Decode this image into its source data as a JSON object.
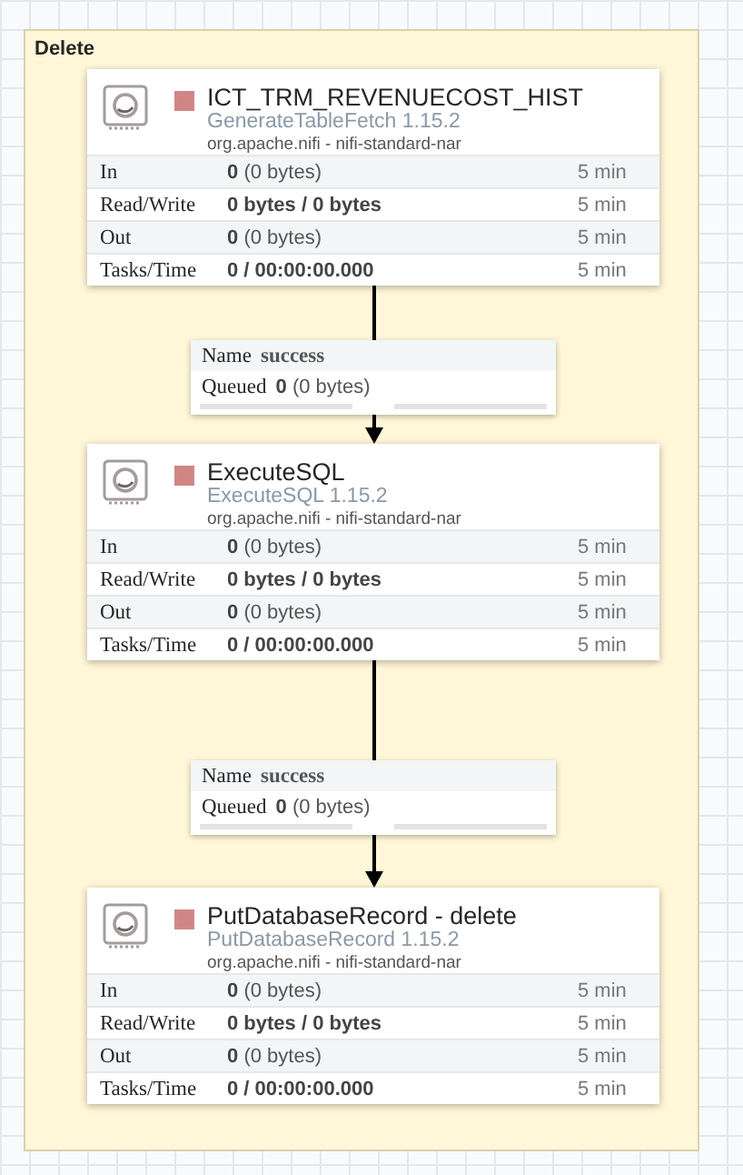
{
  "group": {
    "title": "Delete"
  },
  "flow": [
    {
      "kind": "processor",
      "stopped": true,
      "name": "ICT_TRM_REVENUECOST_HIST",
      "type": "GenerateTableFetch 1.15.2",
      "bundle": "org.apache.nifi - nifi-standard-nar",
      "stats": [
        {
          "label": "In",
          "value": "0",
          "detail": "(0 bytes)",
          "window": "5 min"
        },
        {
          "label": "Read/Write",
          "value": "0 bytes / 0 bytes",
          "window": "5 min"
        },
        {
          "label": "Out",
          "value": "0",
          "detail": "(0 bytes)",
          "window": "5 min"
        },
        {
          "label": "Tasks/Time",
          "value": "0 / 00:00:00.000",
          "window": "5 min"
        }
      ]
    },
    {
      "kind": "connection",
      "name_label": "Name",
      "name": "success",
      "queued_label": "Queued",
      "queued_count": "0",
      "queued_size": "(0 bytes)"
    },
    {
      "kind": "processor",
      "stopped": true,
      "name": "ExecuteSQL",
      "type": "ExecuteSQL 1.15.2",
      "bundle": "org.apache.nifi - nifi-standard-nar",
      "stats": [
        {
          "label": "In",
          "value": "0",
          "detail": "(0 bytes)",
          "window": "5 min"
        },
        {
          "label": "Read/Write",
          "value": "0 bytes / 0 bytes",
          "window": "5 min"
        },
        {
          "label": "Out",
          "value": "0",
          "detail": "(0 bytes)",
          "window": "5 min"
        },
        {
          "label": "Tasks/Time",
          "value": "0 / 00:00:00.000",
          "window": "5 min"
        }
      ]
    },
    {
      "kind": "connection",
      "name_label": "Name",
      "name": "success",
      "queued_label": "Queued",
      "queued_count": "0",
      "queued_size": "(0 bytes)"
    },
    {
      "kind": "processor",
      "stopped": true,
      "name": "PutDatabaseRecord - delete",
      "type": "PutDatabaseRecord 1.15.2",
      "bundle": "org.apache.nifi - nifi-standard-nar",
      "stats": [
        {
          "label": "In",
          "value": "0",
          "detail": "(0 bytes)",
          "window": "5 min"
        },
        {
          "label": "Read/Write",
          "value": "0 bytes / 0 bytes",
          "window": "5 min"
        },
        {
          "label": "Out",
          "value": "0",
          "detail": "(0 bytes)",
          "window": "5 min"
        },
        {
          "label": "Tasks/Time",
          "value": "0 / 00:00:00.000",
          "window": "5 min"
        }
      ]
    }
  ]
}
